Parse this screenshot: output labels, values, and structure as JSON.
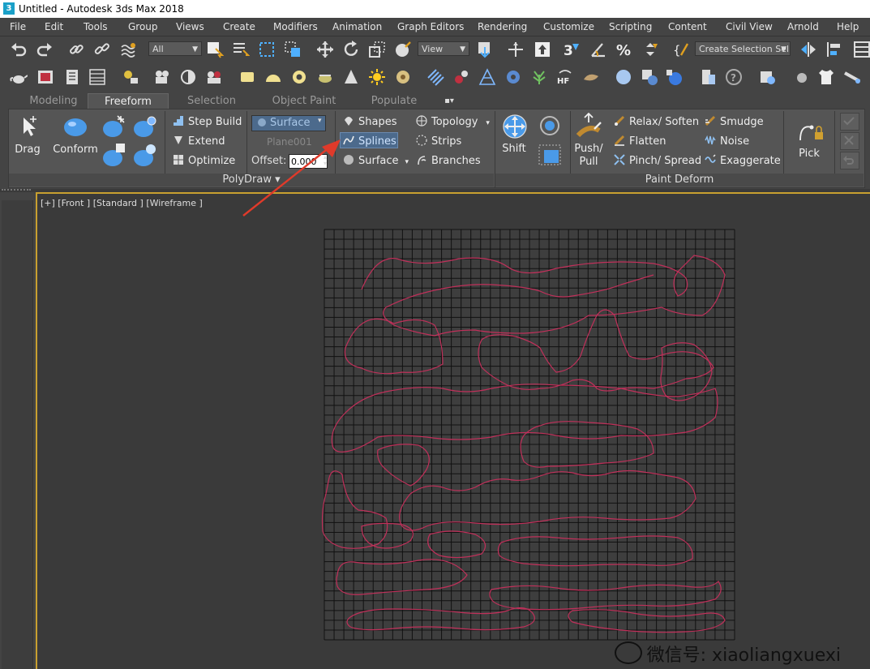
{
  "app": {
    "title": "Untitled - Autodesk 3ds Max 2018",
    "icon_glyph": "3"
  },
  "menu": [
    "File",
    "Edit",
    "Tools",
    "Group",
    "Views",
    "Create",
    "Modifiers",
    "Animation",
    "Graph Editors",
    "Rendering",
    "Customize",
    "Scripting",
    "Content",
    "Civil View",
    "Arnold",
    "Help"
  ],
  "toolbar": {
    "selection_filter": "All",
    "ref_coord": "View",
    "selection_set_placeholder": "Create Selection Sel"
  },
  "ribbon_tabs": [
    {
      "label": "Modeling",
      "active": false
    },
    {
      "label": "Freeform",
      "active": true
    },
    {
      "label": "Selection",
      "active": false
    },
    {
      "label": "Object Paint",
      "active": false
    },
    {
      "label": "Populate",
      "active": false
    }
  ],
  "ribbon_extra": "▪▾",
  "polydraw": {
    "drag": "Drag",
    "conform": "Conform",
    "step_build": "Step Build",
    "extend": "Extend",
    "optimize": "Optimize",
    "surface_dropdown": "Surface",
    "plane_name": "Plane001",
    "offset_label": "Offset:",
    "offset_value": "0.000",
    "shapes": "Shapes",
    "splines": "Splines",
    "surface": "Surface",
    "topology": "Topology",
    "strips": "Strips",
    "branches": "Branches",
    "panel_label": "PolyDraw ▾"
  },
  "paint_deform": {
    "shift": "Shift",
    "push_pull_1": "Push/",
    "push_pull_2": "Pull",
    "relax_soften": "Relax/ Soften",
    "flatten": "Flatten",
    "pinch_spread": "Pinch/ Spread",
    "smudge": "Smudge",
    "noise": "Noise",
    "exaggerate": "Exaggerate",
    "pick": "Pick",
    "panel_label": "Paint Deform"
  },
  "viewport": {
    "label": "[+] [Front ] [Standard ] [Wireframe ]",
    "spline_color": "#c0305a",
    "grid_color": "#111111"
  },
  "watermark": {
    "text": "微信号: xiaoliangxuexi"
  },
  "colors": {
    "accent_blue": "#4a9ae8",
    "viewport_border": "#c8a030",
    "annotation_arrow": "#e03a2a"
  }
}
